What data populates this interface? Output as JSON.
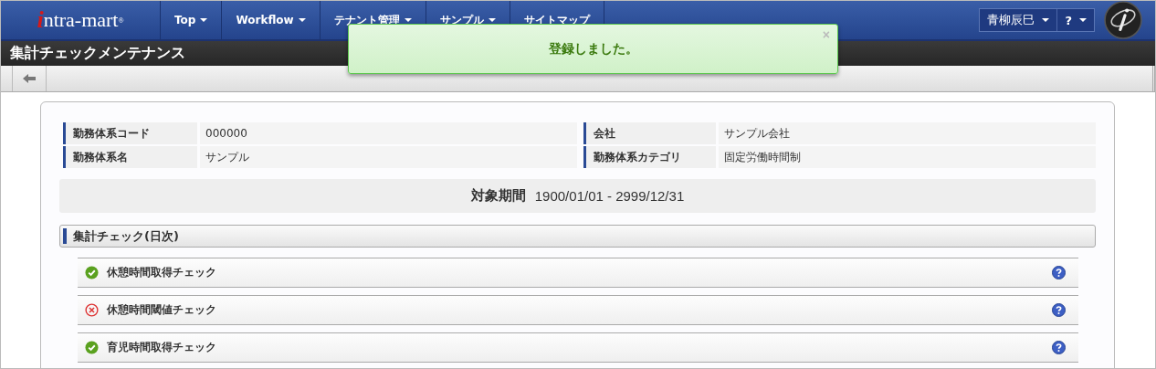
{
  "header": {
    "logo": {
      "initial": "i",
      "rest": "ntra-mart",
      "mark": "®"
    },
    "nav": [
      {
        "label": "Top",
        "dropdown": true
      },
      {
        "label": "Workflow",
        "dropdown": true
      },
      {
        "label": "テナント管理",
        "dropdown": true
      },
      {
        "label": "サンプル",
        "dropdown": true
      },
      {
        "label": "サイトマップ",
        "dropdown": false
      }
    ],
    "user": "青柳辰巳",
    "help": "?"
  },
  "page_title": "集計チェックメンテナンス",
  "toast": {
    "message": "登録しました。",
    "close": "×"
  },
  "info": [
    {
      "label": "勤務体系コード",
      "value": "000000"
    },
    {
      "label": "会社",
      "value": "サンプル会社"
    },
    {
      "label": "勤務体系名",
      "value": "サンプル"
    },
    {
      "label": "勤務体系カテゴリ",
      "value": "固定労働時間制"
    }
  ],
  "period": {
    "label": "対象期間",
    "value": "1900/01/01 - 2999/12/31"
  },
  "section": {
    "title": "集計チェック(日次)"
  },
  "checks": [
    {
      "label": "休憩時間取得チェック",
      "passed": true
    },
    {
      "label": "休憩時間閾値チェック",
      "passed": false
    },
    {
      "label": "育児時間取得チェック",
      "passed": true
    }
  ]
}
